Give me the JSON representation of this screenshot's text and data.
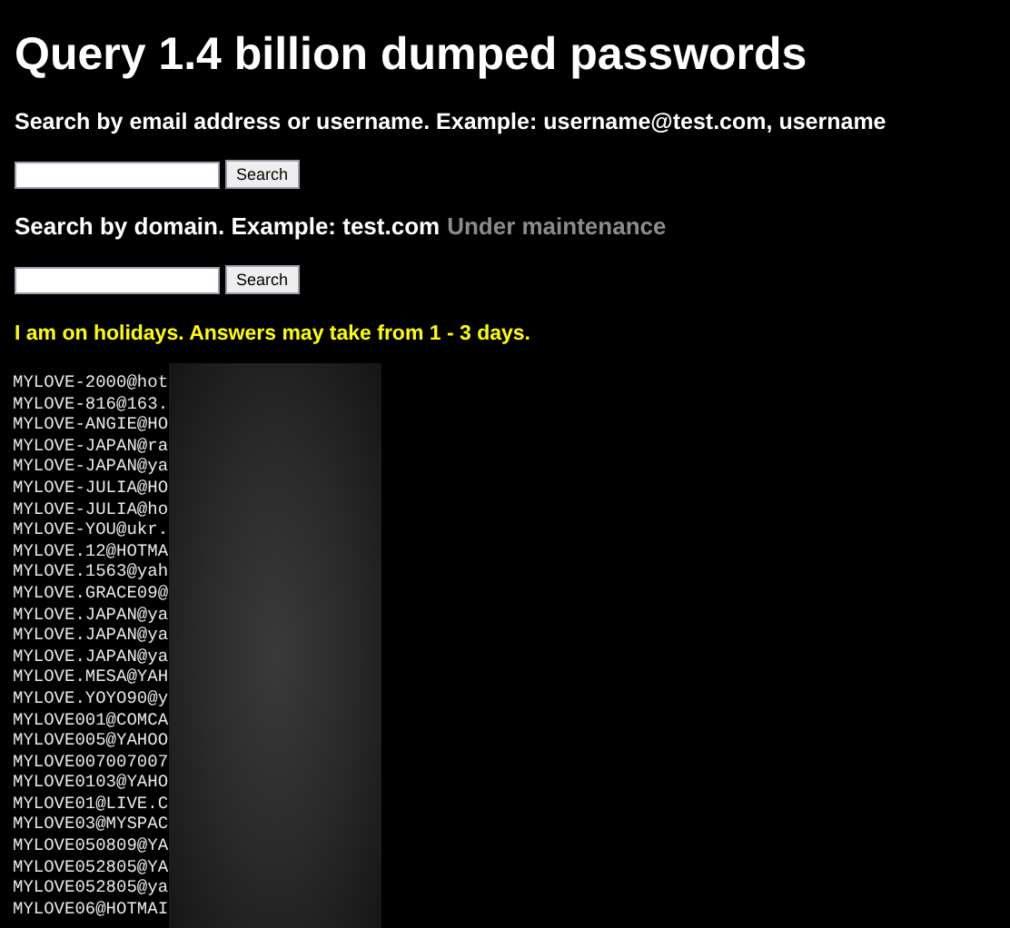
{
  "title": "Query 1.4 billion dumped passwords",
  "email_search": {
    "label": "Search by email address or username. Example: username@test.com, username",
    "button": "Search"
  },
  "domain_search": {
    "label": "Search by domain. Example: test.com",
    "status": "Under maintenance",
    "button": "Search"
  },
  "notice": "I am on holidays. Answers may take from 1 - 3 days.",
  "results": [
    "MYLOVE-2000@hot",
    "MYLOVE-816@163.",
    "MYLOVE-ANGIE@HO",
    "MYLOVE-JAPAN@ra",
    "MYLOVE-JAPAN@ya",
    "MYLOVE-JULIA@HO",
    "MYLOVE-JULIA@ho",
    "MYLOVE-YOU@ukr.",
    "MYLOVE.12@HOTMA",
    "MYLOVE.1563@yah",
    "MYLOVE.GRACE09@",
    "MYLOVE.JAPAN@ya",
    "MYLOVE.JAPAN@ya",
    "MYLOVE.JAPAN@ya",
    "MYLOVE.MESA@YAH",
    "MYLOVE.YOYO90@y",
    "MYLOVE001@COMCA",
    "MYLOVE005@YAHOO",
    "MYLOVE007007007",
    "MYLOVE0103@YAHO",
    "MYLOVE01@LIVE.C",
    "MYLOVE03@MYSPAC",
    "MYLOVE050809@YA",
    "MYLOVE052805@YA",
    "MYLOVE052805@ya",
    "MYLOVE06@HOTMAI"
  ]
}
